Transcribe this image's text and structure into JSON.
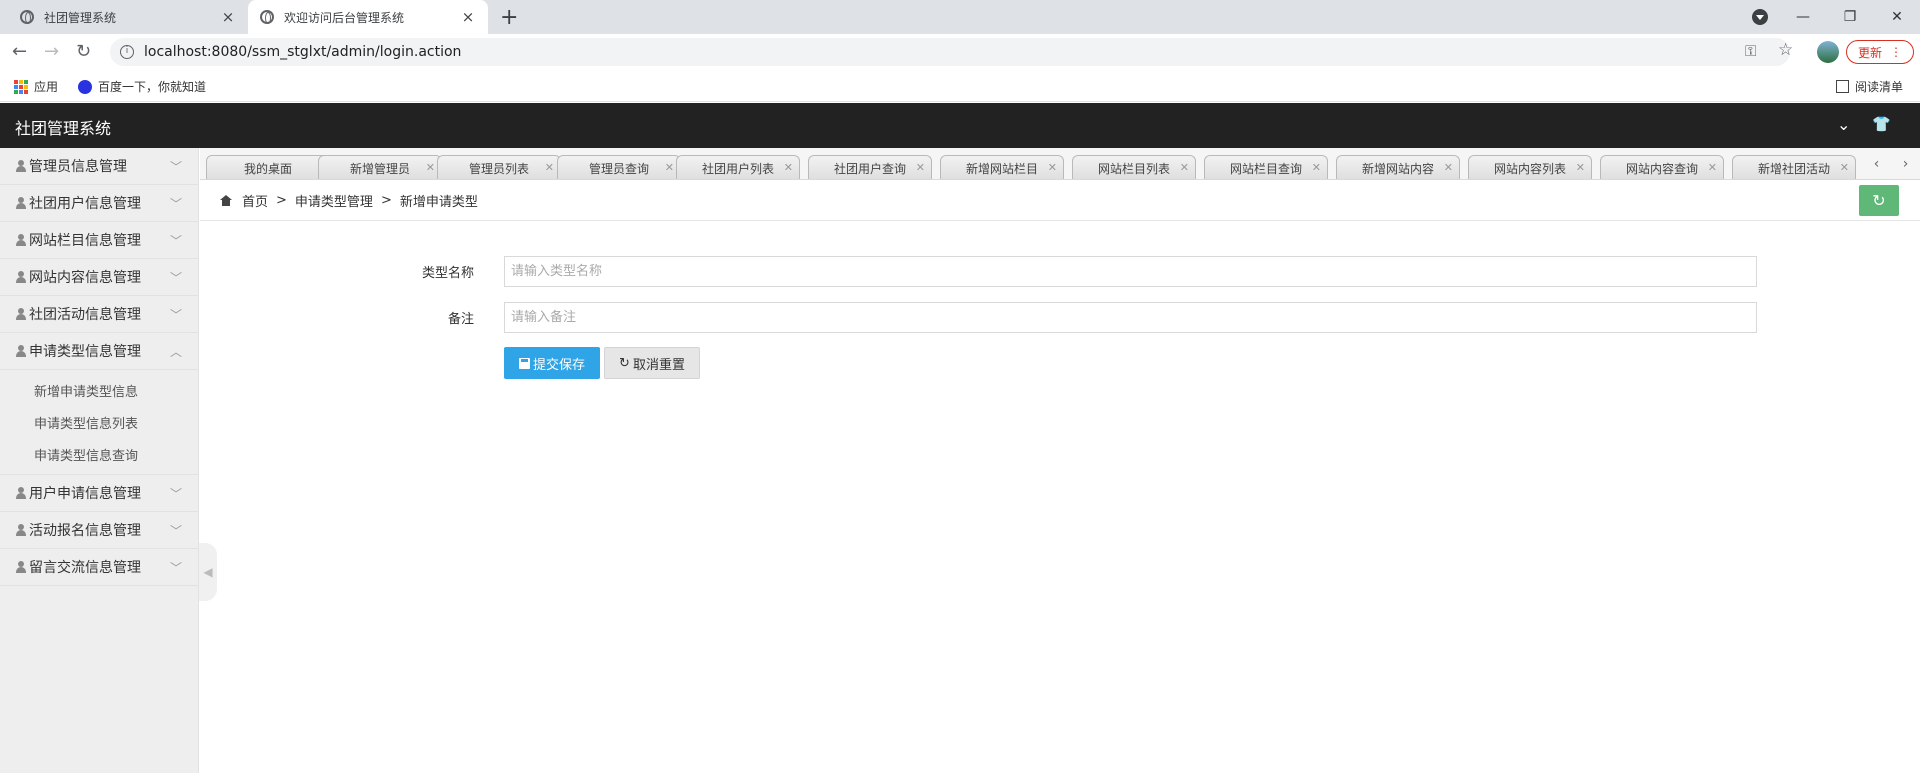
{
  "browser": {
    "tabs": [
      {
        "title": "社团管理系统",
        "close": "×"
      },
      {
        "title": "欢迎访问后台管理系统",
        "close": "×"
      }
    ],
    "new_tab": "+",
    "controls": {
      "minimize": "—",
      "restore": "❐",
      "close": "✕"
    },
    "url": "localhost:8080/ssm_stglxt/admin/login.action",
    "update_label": "更新",
    "bookmarks": {
      "apps": "应用",
      "baidu": "百度一下，你就知道",
      "reading_list": "阅读清单"
    }
  },
  "header": {
    "title": "社团管理系统"
  },
  "sidebar": {
    "menus_before": [
      {
        "label": "管理员信息管理"
      },
      {
        "label": "社团用户信息管理"
      },
      {
        "label": "网站栏目信息管理"
      },
      {
        "label": "网站内容信息管理"
      },
      {
        "label": "社团活动信息管理"
      }
    ],
    "open_menu": {
      "label": "申请类型信息管理",
      "items": [
        "新增申请类型信息",
        "申请类型信息列表",
        "申请类型信息查询"
      ]
    },
    "menus_after": [
      {
        "label": "用户申请信息管理"
      },
      {
        "label": "活动报名信息管理"
      },
      {
        "label": "留言交流信息管理"
      }
    ]
  },
  "content_tabs": [
    "我的桌面",
    "新增管理员",
    "管理员列表",
    "管理员查询",
    "社团用户列表",
    "社团用户查询",
    "新增网站栏目",
    "网站栏目列表",
    "网站栏目查询",
    "新增网站内容",
    "网站内容列表",
    "网站内容查询",
    "新增社团活动"
  ],
  "breadcrumb": {
    "home": "首页",
    "sep": ">",
    "level1": "申请类型管理",
    "level2": "新增申请类型"
  },
  "form": {
    "type_name": {
      "label": "类型名称",
      "placeholder": "请输入类型名称",
      "value": ""
    },
    "remark": {
      "label": "备注",
      "placeholder": "请输入备注",
      "value": ""
    },
    "submit_label": "提交保存",
    "reset_label": "取消重置"
  }
}
